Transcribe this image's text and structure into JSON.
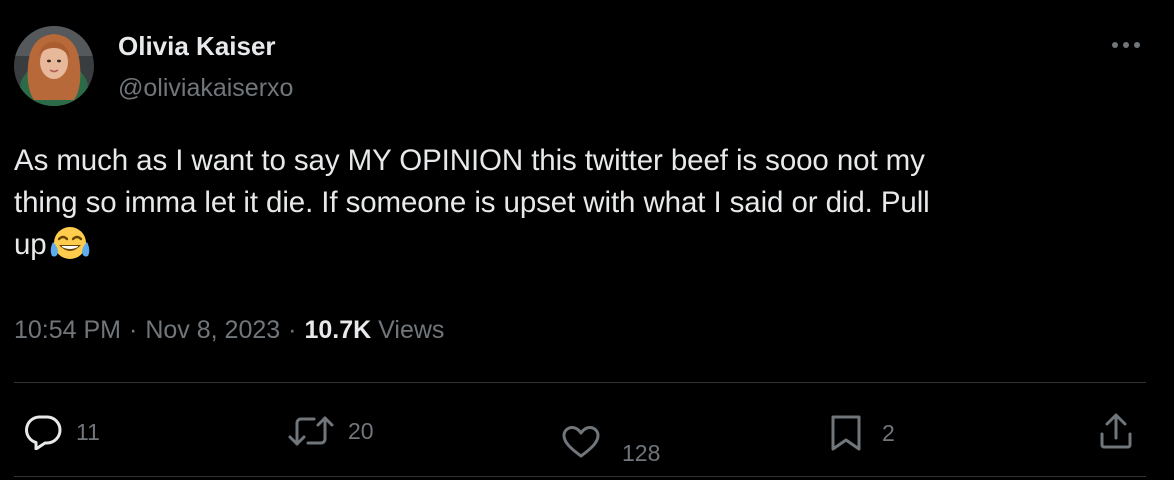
{
  "author": {
    "name": "Olivia Kaiser",
    "handle": "@oliviakaiserxo"
  },
  "tweet": {
    "lines": [
      "As much as I want to say MY OPINION this twitter beef is sooo not my",
      "thing so imma let it die. If someone is upset with what I said or did. Pull",
      "up"
    ],
    "emoji": "face-with-tears-of-joy"
  },
  "meta": {
    "time": "10:54 PM",
    "date": "Nov 8, 2023",
    "views_count": "10.7K",
    "views_label": "Views"
  },
  "actions": {
    "replies": "11",
    "retweets": "20",
    "likes": "128",
    "bookmarks": "2"
  },
  "colors": {
    "background": "#000000",
    "text": "#e7e9ea",
    "muted": "#71767b",
    "divider": "#2f3336"
  },
  "icons": [
    "more-icon",
    "reply-icon",
    "retweet-icon",
    "like-icon",
    "bookmark-icon",
    "share-icon"
  ]
}
